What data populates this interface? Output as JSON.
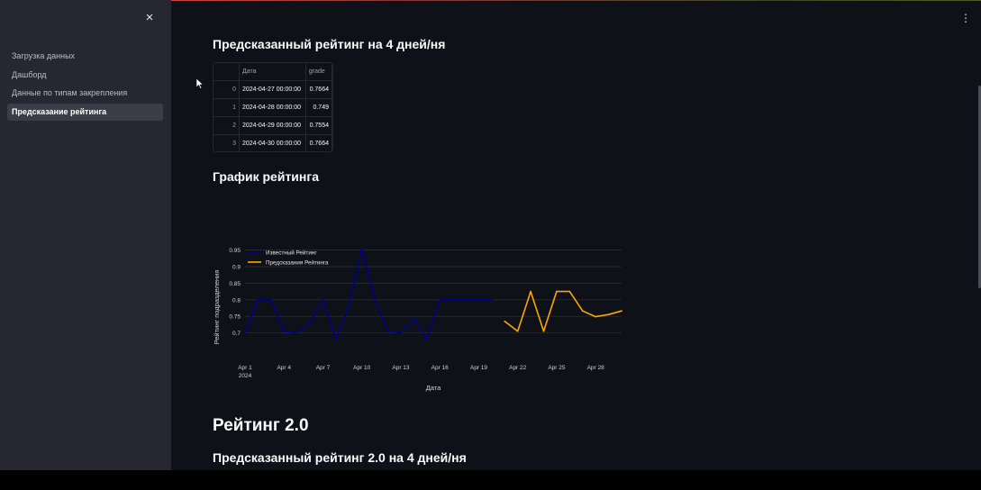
{
  "sidebar": {
    "close_icon": "×",
    "items": [
      {
        "label": "Загрузка данных",
        "active": false
      },
      {
        "label": "Дашборд",
        "active": false
      },
      {
        "label": "Данные по типам закрепления",
        "active": false
      },
      {
        "label": "Предсказание рейтинга",
        "active": true
      }
    ]
  },
  "main": {
    "menu_icon": "⋮",
    "pred_title": "Предсказанный рейтинг на 4 дней/ня",
    "table": {
      "headers": [
        "",
        "Дата",
        "grade"
      ],
      "rows": [
        [
          "0",
          "2024-04-27 00:00:00",
          "0.7664"
        ],
        [
          "1",
          "2024-04-28 00:00:00",
          "0.749"
        ],
        [
          "2",
          "2024-04-29 00:00:00",
          "0.7554"
        ],
        [
          "3",
          "2024-04-30 00:00:00",
          "0.7664"
        ]
      ]
    },
    "chart_title": "График рейтинга",
    "section2_title": "Рейтинг 2.0",
    "pred2_title": "Предсказанный рейтинг 2.0 на 4 дней/ня"
  },
  "colors": {
    "sidebar_bg": "#262730",
    "main_bg": "#0e1117",
    "known_series": "#00008b",
    "predicted_series": "#ffa500"
  },
  "chart_data": {
    "type": "line",
    "title": "",
    "xlabel": "Дата",
    "ylabel": "Рейтинг подразделения",
    "ylim": [
      0.65,
      0.96
    ],
    "xlim": [
      "2024-04-01",
      "2024-04-30"
    ],
    "x_ticks": [
      "Apr 1",
      "Apr 4",
      "Apr 7",
      "Apr 10",
      "Apr 13",
      "Apr 16",
      "Apr 19",
      "Apr 22",
      "Apr 25",
      "Apr 28"
    ],
    "x_tick_sub": "2024",
    "y_ticks": [
      "0.7",
      "0.75",
      "0.8",
      "0.85",
      "0.9",
      "0.95"
    ],
    "grid": true,
    "legend_position": "top-left",
    "series": [
      {
        "name": "Известный Рейтинг",
        "color": "#00008b",
        "x": [
          "2024-04-01",
          "2024-04-02",
          "2024-04-03",
          "2024-04-04",
          "2024-04-05",
          "2024-04-06",
          "2024-04-07",
          "2024-04-08",
          "2024-04-09",
          "2024-04-10",
          "2024-04-11",
          "2024-04-12",
          "2024-04-13",
          "2024-04-14",
          "2024-04-15",
          "2024-04-16",
          "2024-04-17",
          "2024-04-18",
          "2024-04-19",
          "2024-04-20"
        ],
        "y": [
          0.7,
          0.8,
          0.8,
          0.705,
          0.7,
          0.73,
          0.8,
          0.68,
          0.78,
          0.955,
          0.8,
          0.705,
          0.7,
          0.745,
          0.68,
          0.8,
          0.8,
          0.8,
          0.8,
          0.8
        ]
      },
      {
        "name": "Предсказания Рейтинга",
        "color": "#ffa500",
        "x": [
          "2024-04-21",
          "2024-04-22",
          "2024-04-23",
          "2024-04-24",
          "2024-04-25",
          "2024-04-26",
          "2024-04-27",
          "2024-04-28",
          "2024-04-29",
          "2024-04-30"
        ],
        "y": [
          0.735,
          0.705,
          0.825,
          0.705,
          0.825,
          0.825,
          0.7664,
          0.749,
          0.7554,
          0.7664
        ]
      }
    ]
  }
}
